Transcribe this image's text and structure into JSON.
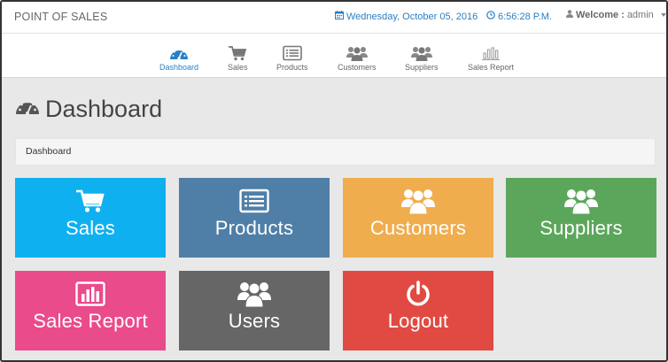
{
  "header": {
    "brand": "POINT OF SALES",
    "date": "Wednesday, October 05, 2016",
    "time": "6:56:28 P.M.",
    "welcome_label": "Welcome :",
    "username": "admin"
  },
  "nav": {
    "items": [
      {
        "label": "Dashboard",
        "icon": "dashboard-icon",
        "active": true
      },
      {
        "label": "Sales",
        "icon": "cart-icon"
      },
      {
        "label": "Products",
        "icon": "list-icon"
      },
      {
        "label": "Customers",
        "icon": "users-icon"
      },
      {
        "label": "Suppliers",
        "icon": "users-icon"
      },
      {
        "label": "Sales Report",
        "icon": "bar-chart-icon"
      }
    ]
  },
  "page": {
    "title": "Dashboard",
    "breadcrumb": "Dashboard"
  },
  "tiles": [
    {
      "label": "Sales",
      "icon": "cart-icon",
      "color": "#0fb0ef"
    },
    {
      "label": "Products",
      "icon": "list-icon",
      "color": "#4f7fa7"
    },
    {
      "label": "Customers",
      "icon": "users-icon",
      "color": "#f0ad4e"
    },
    {
      "label": "Suppliers",
      "icon": "users-icon",
      "color": "#5ca65c"
    },
    {
      "label": "Sales Report",
      "icon": "bar-chart-icon",
      "color": "#ea4b8b"
    },
    {
      "label": "Users",
      "icon": "users-icon",
      "color": "#666666"
    },
    {
      "label": "Logout",
      "icon": "power-icon",
      "color": "#e14a42"
    }
  ],
  "colors": {
    "accent": "#2a7fc4",
    "background": "#e8e8e8"
  }
}
